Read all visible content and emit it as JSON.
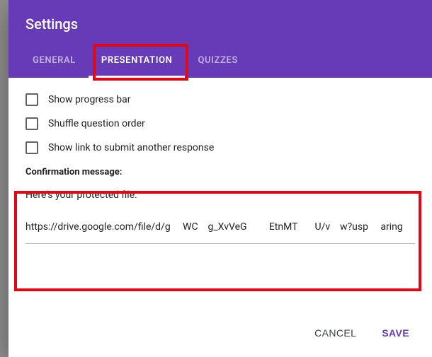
{
  "header": {
    "title": "Settings",
    "tabs": {
      "general": "General",
      "presentation": "Presentation",
      "quizzes": "Quizzes"
    }
  },
  "options": {
    "progress_bar": "Show progress bar",
    "shuffle": "Shuffle question order",
    "submit_another": "Show link to submit another response"
  },
  "confirmation": {
    "label": "Confirmation message:",
    "value": "Here's your protected file:\n\nhttps://drive.google.com/file/d/g     WC    g_XvVeG         EtnMT       U/v    w?usp     aring"
  },
  "actions": {
    "cancel": "Cancel",
    "save": "Save"
  }
}
